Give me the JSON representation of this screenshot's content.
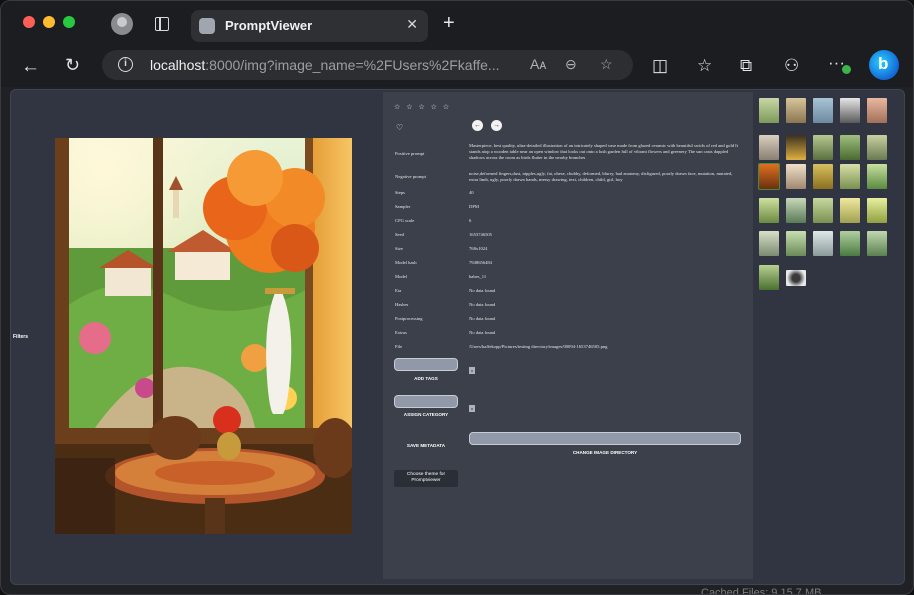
{
  "browser": {
    "tab_title": "PromptViewer",
    "url_host": "localhost",
    "url_rest": ":8000/img?image_name=%2FUsers%2Fkaffe...",
    "read_aloud_icon": "Aᴀ"
  },
  "sidebar": {
    "filters_label": "Filters"
  },
  "viewer": {
    "stars": "☆ ☆ ☆ ☆ ☆",
    "heart": "♡",
    "prev": "←",
    "next": "→"
  },
  "metadata": [
    {
      "label": "Positive prompt",
      "value": "Masterpiece, best quality, ultra-detailed illustration of an intricately shaped vase made from glazed ceramic with beautiful swirls of red and gold It stands atop a wooden table near an open window that looks out onto a lush garden full of vibrant flowers and greenery The sun casts dappled shadows across the room as birds flutter in the nearby branches"
    },
    {
      "label": "Negative prompt",
      "value": "noise,deformed fingers,dust, nipples,ugly, fat, obese, chubby, deformed, blurry, bad anatomy, disfigured, poorly drawn face, mutation, mutated, extra limb, ugly, poorly drawn hands, messy drawing, text, children, child, girl, boy"
    },
    {
      "label": "Steps",
      "value": "40"
    },
    {
      "label": "Sampler",
      "value": "DPM"
    },
    {
      "label": "CFG scale",
      "value": "6"
    },
    {
      "label": "Seed",
      "value": "1653746505"
    },
    {
      "label": "Size",
      "value": "768x1024"
    },
    {
      "label": "Model hash",
      "value": "7948656484"
    },
    {
      "label": "Model",
      "value": "babes_11"
    },
    {
      "label": "Eta",
      "value": "No data found"
    },
    {
      "label": "Hashes",
      "value": "No data found"
    },
    {
      "label": "Postprocessing",
      "value": "No data found"
    },
    {
      "label": "Extras",
      "value": "No data found"
    },
    {
      "label": "File",
      "value": "/Users/kaffekopp/Pictures/testing directory/images/00094-1653746505.png"
    }
  ],
  "actions": {
    "add_tags": "ADD TAGS",
    "assign_category": "ASSIGN CATEGORY",
    "save_metadata": "SAVE METADATA",
    "change_dir": "CHANGE IMAGE DIRECTORY",
    "choose_theme_line1": "Choose theme for",
    "choose_theme_line2": "Promptviewer",
    "x_mark": "x"
  },
  "status_bar": {
    "partial_text": "Cached Files:     9.15.7 MB"
  }
}
